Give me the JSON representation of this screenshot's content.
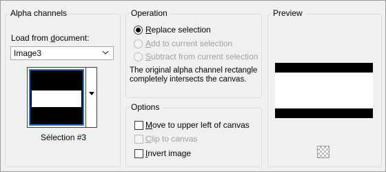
{
  "alpha_channels": {
    "title": "Alpha channels",
    "load_label_pre": "Load from ",
    "load_label_u": "d",
    "load_label_post": "ocument:",
    "document_value": "Image3",
    "selection_name": "Sélection #3"
  },
  "operation": {
    "title": "Operation",
    "options": [
      {
        "pre": "",
        "u": "R",
        "post": "eplace selection",
        "checked": true,
        "enabled": true
      },
      {
        "pre": "",
        "u": "A",
        "post": "dd to current selection",
        "checked": false,
        "enabled": false
      },
      {
        "pre": "",
        "u": "S",
        "post": "ubtract from current selection",
        "checked": false,
        "enabled": false
      }
    ],
    "description": "The original alpha channel rectangle completely intersects the canvas."
  },
  "options_group": {
    "title": "Options",
    "items": [
      {
        "pre": "",
        "u": "M",
        "post": "ove to upper left of canvas",
        "checked": false,
        "enabled": true
      },
      {
        "pre": "",
        "u": "C",
        "post": "lip to canvas",
        "checked": false,
        "enabled": false
      },
      {
        "pre": "",
        "u": "I",
        "post": "nvert image",
        "checked": false,
        "enabled": true
      }
    ]
  },
  "preview": {
    "title": "Preview"
  }
}
